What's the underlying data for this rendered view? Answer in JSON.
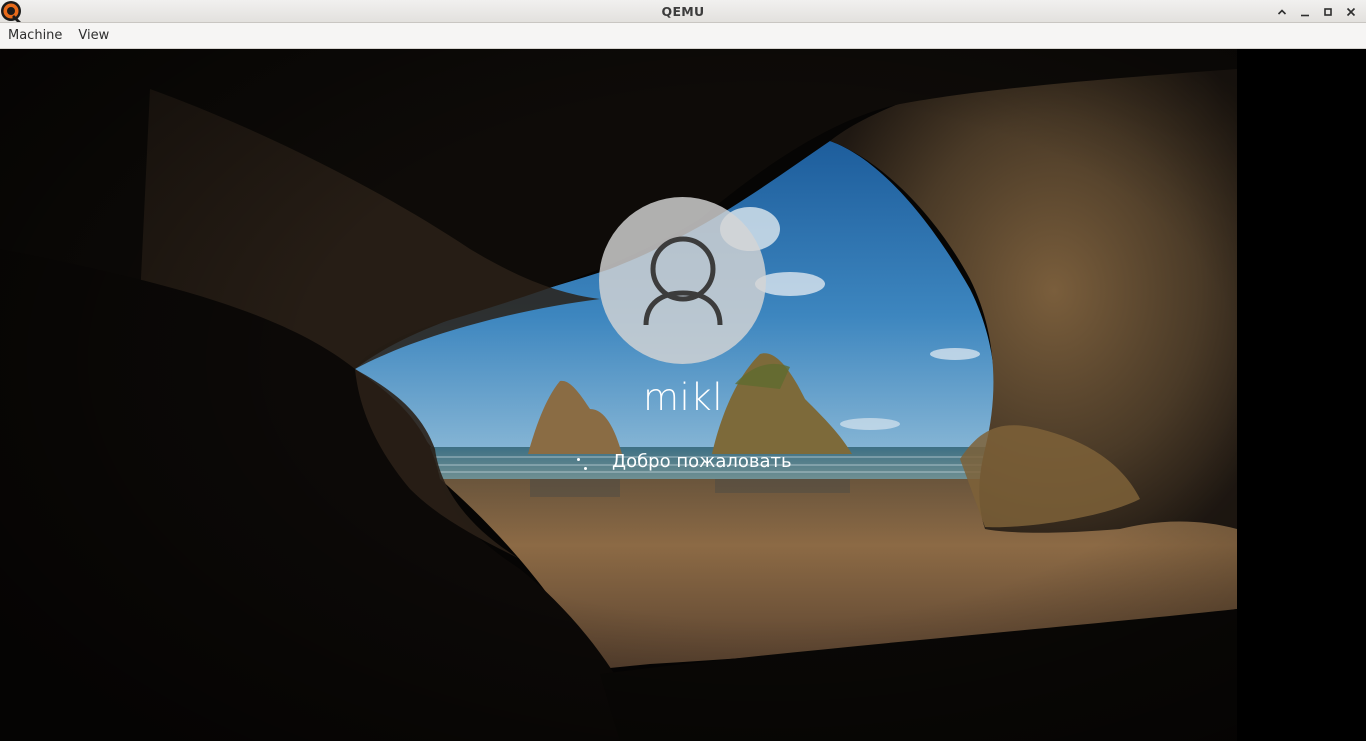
{
  "window": {
    "title": "QEMU",
    "app_icon": "qemu-logo-icon",
    "controls": [
      "maximize-up-icon",
      "minimize-icon",
      "restore-icon",
      "close-icon"
    ]
  },
  "menubar": {
    "items": [
      {
        "label": "Machine"
      },
      {
        "label": "View"
      }
    ]
  },
  "guest": {
    "screen": "windows-lock-screen",
    "user": {
      "avatar_icon": "user-avatar-icon",
      "name": "mikl"
    },
    "status": {
      "icon": "loading-spinner-icon",
      "text": "Добро пожаловать"
    }
  },
  "colors": {
    "titlebar": "#e8e6e3",
    "menubar": "#f6f5f4",
    "sky": "#2f6fa8",
    "sand": "#8c6a45",
    "rock": "#3a2e22"
  }
}
